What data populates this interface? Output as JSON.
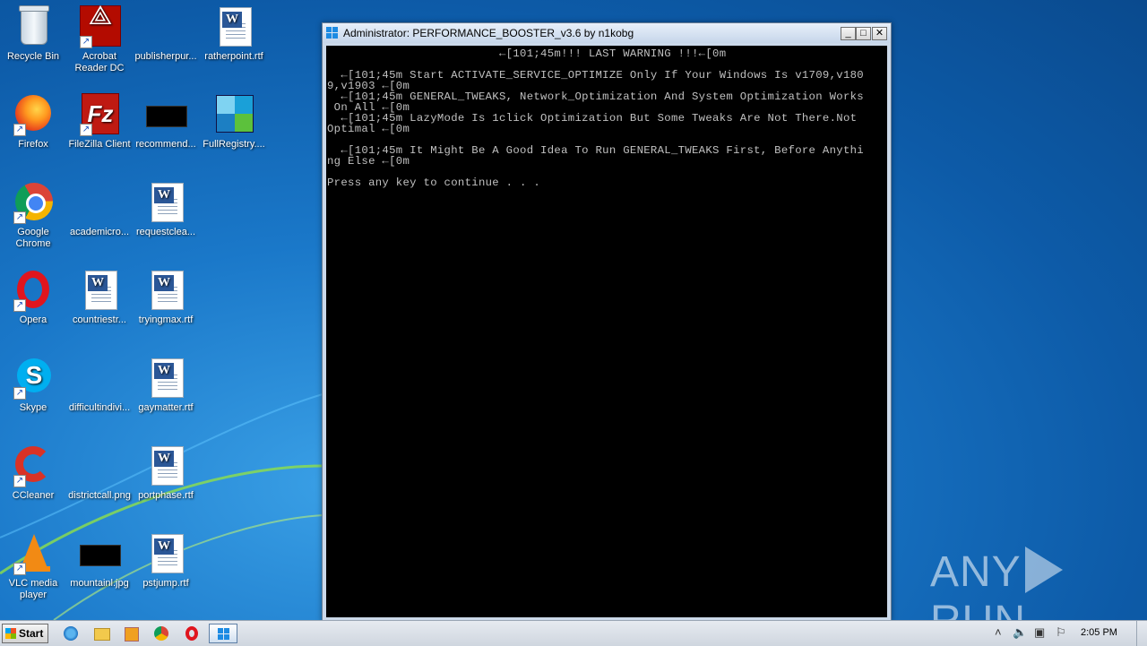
{
  "desktop": {
    "icons": [
      {
        "label": "Recycle Bin",
        "icon": "recycle-bin-icon"
      },
      {
        "label": "Acrobat Reader DC",
        "icon": "acrobat-icon"
      },
      {
        "label": "publisherpur...",
        "icon": "blank-file-icon"
      },
      {
        "label": "ratherpoint.rtf",
        "icon": "word-document-icon"
      },
      {
        "label": "Firefox",
        "icon": "firefox-icon"
      },
      {
        "label": "FileZilla Client",
        "icon": "filezilla-icon"
      },
      {
        "label": "recommend...",
        "icon": "black-image-icon"
      },
      {
        "label": "FullRegistry....",
        "icon": "registry-icon"
      },
      {
        "label": "Google Chrome",
        "icon": "chrome-icon"
      },
      {
        "label": "academicro...",
        "icon": "blank-file-icon"
      },
      {
        "label": "requestclea...",
        "icon": "word-document-icon"
      },
      {
        "label": "Opera",
        "icon": "opera-icon"
      },
      {
        "label": "countriestr...",
        "icon": "word-document-icon"
      },
      {
        "label": "tryingmax.rtf",
        "icon": "word-document-icon"
      },
      {
        "label": "Skype",
        "icon": "skype-icon"
      },
      {
        "label": "difficultindivi...",
        "icon": "blank-file-icon"
      },
      {
        "label": "gaymatter.rtf",
        "icon": "word-document-icon"
      },
      {
        "label": "CCleaner",
        "icon": "ccleaner-icon"
      },
      {
        "label": "districtcall.png",
        "icon": "blank-file-icon"
      },
      {
        "label": "portphase.rtf",
        "icon": "word-document-icon"
      },
      {
        "label": "VLC media player",
        "icon": "vlc-icon"
      },
      {
        "label": "mountainl.jpg",
        "icon": "black-image-icon"
      },
      {
        "label": "pstjump.rtf",
        "icon": "word-document-icon"
      }
    ]
  },
  "window": {
    "title": "Administrator:  PERFORMANCE_BOOSTER_v3.6 by n1kobg",
    "minimize": "0",
    "maximize": "1",
    "close": "r",
    "console_text": "                         ←[101;45m!!! LAST WARNING !!!←[0m\n\n  ←[101;45m Start ACTIVATE_SERVICE_OPTIMIZE Only If Your Windows Is v1709,v180\n9,v1903 ←[0m\n  ←[101;45m GENERAL_TWEAKS, Network_Optimization And System Optimization Works\n On All ←[0m\n  ←[101;45m LazyMode Is 1click Optimization But Some Tweaks Are Not There.Not\nOptimal ←[0m\n\n  ←[101;45m It Might Be A Good Idea To Run GENERAL_TWEAKS First, Before Anythi\nng Else ←[0m\n\nPress any key to continue . . ."
  },
  "watermark": {
    "left": "ANY",
    "right": "RUN"
  },
  "taskbar": {
    "start_label": "Start",
    "clock": "2:05 PM"
  },
  "colors": {
    "console_bg": "#000000",
    "console_fg": "#c0c0c0",
    "desktop": "#1a78c9"
  }
}
